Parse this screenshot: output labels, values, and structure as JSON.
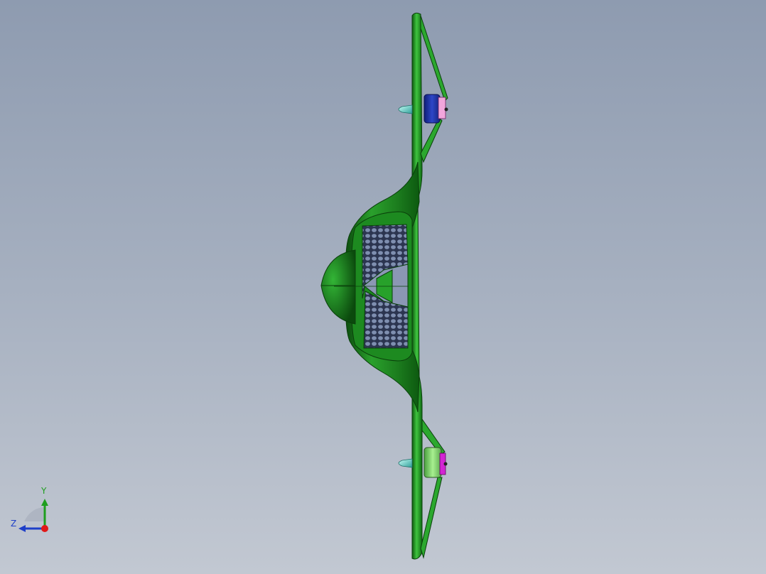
{
  "viewport": {
    "background_top": "#8e9bb0",
    "background_bottom": "#c2c8d2"
  },
  "model": {
    "frame_color": "#1f8f1f",
    "frame_highlight": "#3fc43f",
    "mesh_color": "#4a5a80",
    "motor_top_color": "#2236a8",
    "motor_bottom_color": "#8fe07a",
    "motor_mount_top_color": "#f0a0d8",
    "motor_mount_bottom_color": "#d020d0",
    "spinner_color": "#5fd0c8"
  },
  "triad": {
    "y_label": "Y",
    "z_label": "Z",
    "y_color": "#1e9e1e",
    "z_color": "#1e3fc8",
    "x_color": "#e01818"
  }
}
